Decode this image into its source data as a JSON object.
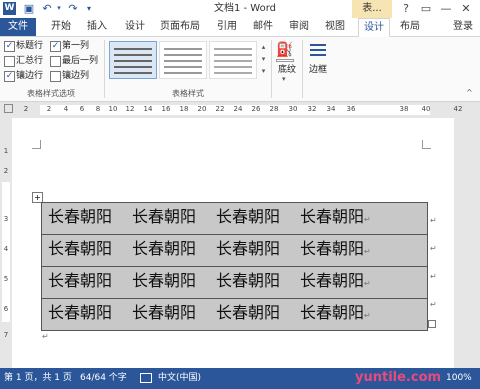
{
  "titlebar": {
    "title": "文档1 - Word",
    "table_tools": "表...",
    "help": "?",
    "minimize": "—",
    "restore": "❐",
    "close": "✕",
    "save_icon": "💾",
    "undo": "↶",
    "redo": "↷"
  },
  "tabs": {
    "file": "文件",
    "home": "开始",
    "insert": "插入",
    "design": "设计",
    "layout_page": "页面布局",
    "references": "引用",
    "mailings": "邮件",
    "review": "审阅",
    "view": "视图",
    "table_design": "设计",
    "table_layout": "布局",
    "signin": "登录"
  },
  "ribbon": {
    "options": {
      "header_row": "标题行",
      "first_column": "第一列",
      "total_row": "汇总行",
      "last_column": "最后一列",
      "banded_rows": "镶边行",
      "banded_columns": "镶边列",
      "group_label": "表格样式选项"
    },
    "styles_group_label": "表格样式",
    "shading_label": "底纹",
    "borders_label": "边框"
  },
  "ruler": {
    "numbers": [
      "2",
      "2",
      "4",
      "6",
      "8",
      "10",
      "12",
      "14",
      "16",
      "18",
      "20",
      "22",
      "24",
      "26",
      "28",
      "30",
      "32",
      "34",
      "36",
      "38",
      "40",
      "42"
    ],
    "vnumbers": [
      "1",
      "2",
      "3",
      "4",
      "5",
      "6",
      "7"
    ]
  },
  "document": {
    "rows": [
      [
        "长春朝阳",
        "长春朝阳",
        "长春朝阳",
        "长春朝阳"
      ],
      [
        "长春朝阳",
        "长春朝阳",
        "长春朝阳",
        "长春朝阳"
      ],
      [
        "长春朝阳",
        "长春朝阳",
        "长春朝阳",
        "长春朝阳"
      ],
      [
        "长春朝阳",
        "长春朝阳",
        "长春朝阳",
        "长春朝阳"
      ]
    ],
    "paragraph_mark": "↵",
    "move_handle": "+"
  },
  "status": {
    "page": "第 1 页，共 1 页",
    "words": "64/64 个字",
    "language": "中文(中国)",
    "zoom": "100%",
    "watermark": "yuntile.com"
  },
  "colors": {
    "accent": "#2b579a",
    "table_fill": "#c8c8c8"
  }
}
